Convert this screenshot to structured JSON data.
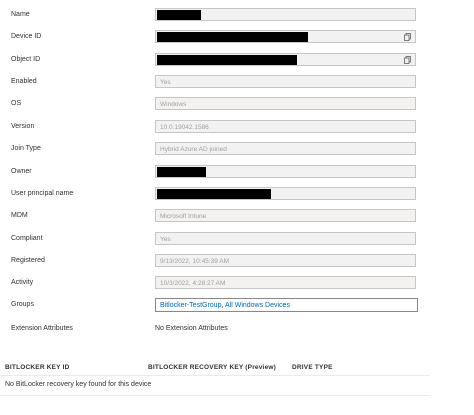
{
  "properties": [
    {
      "label": "Name",
      "value": "",
      "redacted": true,
      "copy": false
    },
    {
      "label": "Device ID",
      "value": "",
      "redacted": true,
      "copy": true
    },
    {
      "label": "Object ID",
      "value": "",
      "redacted": true,
      "copy": true
    },
    {
      "label": "Enabled",
      "value": "Yes",
      "redacted": false,
      "copy": false
    },
    {
      "label": "OS",
      "value": "Windows",
      "redacted": false,
      "copy": false
    },
    {
      "label": "Version",
      "value": "10.0.19042.1586",
      "redacted": false,
      "copy": false
    },
    {
      "label": "Join Type",
      "value": "Hybrid Azure AD joined",
      "redacted": false,
      "copy": false
    },
    {
      "label": "Owner",
      "value": "",
      "redacted": true,
      "copy": false
    },
    {
      "label": "User principal name",
      "value": "",
      "redacted": true,
      "copy": false
    },
    {
      "label": "MDM",
      "value": "Microsoft Intune",
      "redacted": false,
      "copy": false
    },
    {
      "label": "Compliant",
      "value": "Yes",
      "redacted": false,
      "copy": false
    },
    {
      "label": "Registered",
      "value": "9/13/2022, 10:45:39 AM",
      "redacted": false,
      "copy": false
    },
    {
      "label": "Activity",
      "value": "10/3/2022, 4:28:27 AM",
      "redacted": false,
      "copy": false
    }
  ],
  "groups": {
    "label": "Groups",
    "links": [
      "Bitlocker-TestGroup",
      "All Windows Devices"
    ],
    "separator": ","
  },
  "extension": {
    "label": "Extension Attributes",
    "value": "No Extension Attributes"
  },
  "bitlocker_table": {
    "columns": [
      "BITLOCKER KEY ID",
      "BITLOCKER RECOVERY KEY (Preview)",
      "DRIVE TYPE"
    ],
    "empty_message": "No BitLocker recovery key found for this device"
  },
  "icons": {
    "copy": "copy-icon"
  }
}
